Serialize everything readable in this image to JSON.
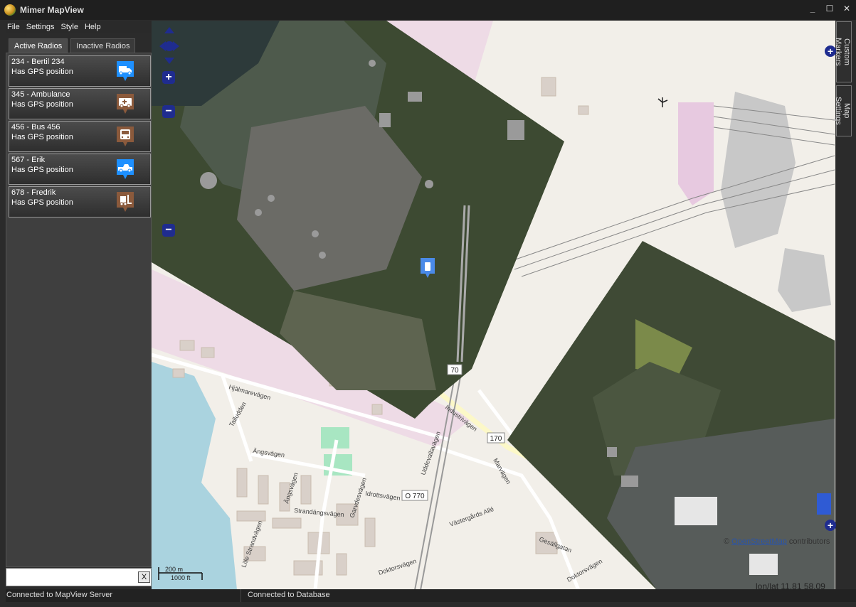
{
  "window": {
    "title": "Mimer MapView",
    "controls": [
      "_",
      "☐",
      "✕"
    ]
  },
  "menu": [
    "File",
    "Settings",
    "Style",
    "Help"
  ],
  "tabs": [
    {
      "label": "Active Radios",
      "active": true
    },
    {
      "label": "Inactive Radios",
      "active": false
    }
  ],
  "radios": [
    {
      "name": "234 - Bertil 234",
      "status": "Has GPS position",
      "icon": "truck-icon",
      "color": "#1e90ff"
    },
    {
      "name": "345 - Ambulance",
      "status": "Has GPS position",
      "icon": "ambulance-icon",
      "color": "#8b5a3c"
    },
    {
      "name": "456 - Bus 456",
      "status": "Has GPS position",
      "icon": "bus-icon",
      "color": "#8b5a3c"
    },
    {
      "name": "567 - Erik",
      "status": "Has GPS position",
      "icon": "pickup-icon",
      "color": "#1e90ff"
    },
    {
      "name": "678 - Fredrik",
      "status": "Has GPS position",
      "icon": "forklift-icon",
      "color": "#8b5a3c"
    }
  ],
  "filter": {
    "value": "",
    "clear_label": "X"
  },
  "status": {
    "server": "Connected to MapView Server",
    "database": "Connected to Database"
  },
  "side_tabs": [
    "Custom Markers",
    "Map Settings"
  ],
  "map": {
    "zoom_in": "+",
    "zoom_out": "−",
    "scale_top": "200 m",
    "scale_bottom": "1000 ft",
    "attribution_prefix": "©",
    "attribution_link": "OpenStreetMap",
    "attribution_suffix": "contributors",
    "coords": "lon/lat 11.81 58.09",
    "labels": {
      "road_70": "70",
      "road_170": "170",
      "road_o770": "O 770",
      "industrivagen": "Industrivägen",
      "uddevallavagen": "Uddevallavägen",
      "hjalmarevagen": "Hjälmarevägen",
      "talludden": "Talludden",
      "angsvagen": "Ängsvägen",
      "angsvagen2": "Ängsvägen",
      "strandangsvagen": "Strandängsvägen",
      "idrottsvagen": "Idrottsvägen",
      "garvdesvagen": "Garvdesvägen",
      "lille_strandvagen": "Lille Strandvägen",
      "vastergards_alle": "Västergårds Allé",
      "doktorsvagen": "Doktorsvägen",
      "marvagen": "Marvägen",
      "gesallgatan": "Gesällgatan",
      "doktorsvagen2": "Doktorsvägen"
    }
  }
}
